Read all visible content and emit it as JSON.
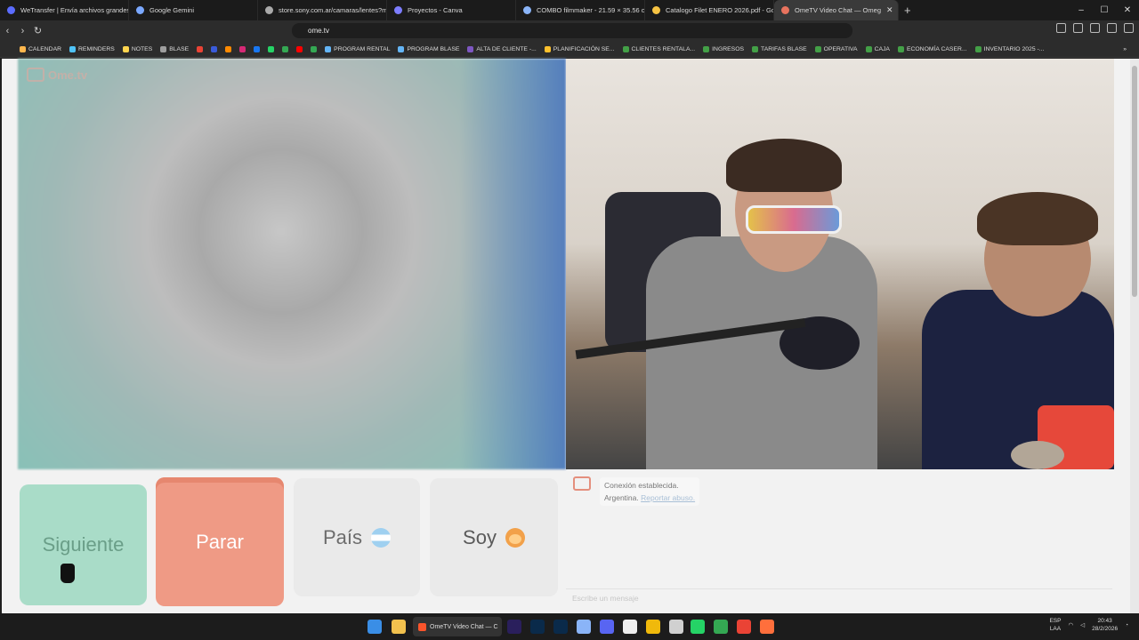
{
  "browser": {
    "tabs": [
      {
        "label": "WeTransfer | Envía archivos grandes",
        "color": "#5b6cff"
      },
      {
        "label": "Google Gemini",
        "color": "#7aa8ff"
      },
      {
        "label": "store.sony.com.ar/camaras/lentes?m",
        "color": "#aaaaaa"
      },
      {
        "label": "Proyectos - Canva",
        "color": "#7d7dff"
      },
      {
        "label": "COMBO filmmaker - 21.59 × 35.56 c",
        "color": "#8ab4f8"
      },
      {
        "label": "Catalogo Filet ENERO 2026.pdf - Goo",
        "color": "#f6c343"
      },
      {
        "label": "OmeTV Video Chat — Omeg",
        "color": "#e8735e"
      }
    ],
    "new_tab": "+",
    "url": "ome.tv",
    "window_controls": [
      "–",
      "☐",
      "✕"
    ],
    "bookmarks": [
      {
        "label": "CALENDAR",
        "color": "#ffb74d"
      },
      {
        "label": "REMINDERS",
        "color": "#4fc3f7"
      },
      {
        "label": "NOTES",
        "color": "#ffd54f"
      },
      {
        "label": "BLASE",
        "color": "#9e9e9e"
      },
      {
        "label": "",
        "color": "#ea4335"
      },
      {
        "label": "",
        "color": "#3a5bd9"
      },
      {
        "label": "",
        "color": "#ff8a00"
      },
      {
        "label": "",
        "color": "#d62976"
      },
      {
        "label": "",
        "color": "#1877f2"
      },
      {
        "label": "",
        "color": "#25d366"
      },
      {
        "label": "",
        "color": "#34a853"
      },
      {
        "label": "",
        "color": "#ff0000"
      },
      {
        "label": "",
        "color": "#34a853"
      },
      {
        "label": "PROGRAM RENTAL",
        "color": "#64b5f6"
      },
      {
        "label": "PROGRAM BLASE",
        "color": "#64b5f6"
      },
      {
        "label": "ALTA DE CLIENTE -...",
        "color": "#7e57c2"
      },
      {
        "label": "PLANIFICACIÓN SE...",
        "color": "#fbc02d"
      },
      {
        "label": "CLIENTES RENTALA...",
        "color": "#43a047"
      },
      {
        "label": "INGRESOS",
        "color": "#43a047"
      },
      {
        "label": "TARIFAS BLASE",
        "color": "#43a047"
      },
      {
        "label": "OPERATIVA",
        "color": "#43a047"
      },
      {
        "label": "CAJA",
        "color": "#43a047"
      },
      {
        "label": "ECONOMÍA CASER...",
        "color": "#43a047"
      },
      {
        "label": "INVENTARIO 2025 -...",
        "color": "#43a047"
      }
    ],
    "bookmarks_more": "»"
  },
  "app": {
    "logo": "Ome.tv",
    "buttons": {
      "next": "Siguiente",
      "stop": "Parar",
      "country": "País",
      "me": "Soy"
    },
    "chat": {
      "status": "Conexión establecida.",
      "country": "Argentina.",
      "report": "Reportar abuso.",
      "placeholder": "Escribe un mensaje"
    }
  },
  "taskbar": {
    "active_task": "OmeTV Video Chat — C",
    "lang": "ESP",
    "lang_sub": "LAA",
    "time": "20:43",
    "date": "28/2/2026"
  }
}
